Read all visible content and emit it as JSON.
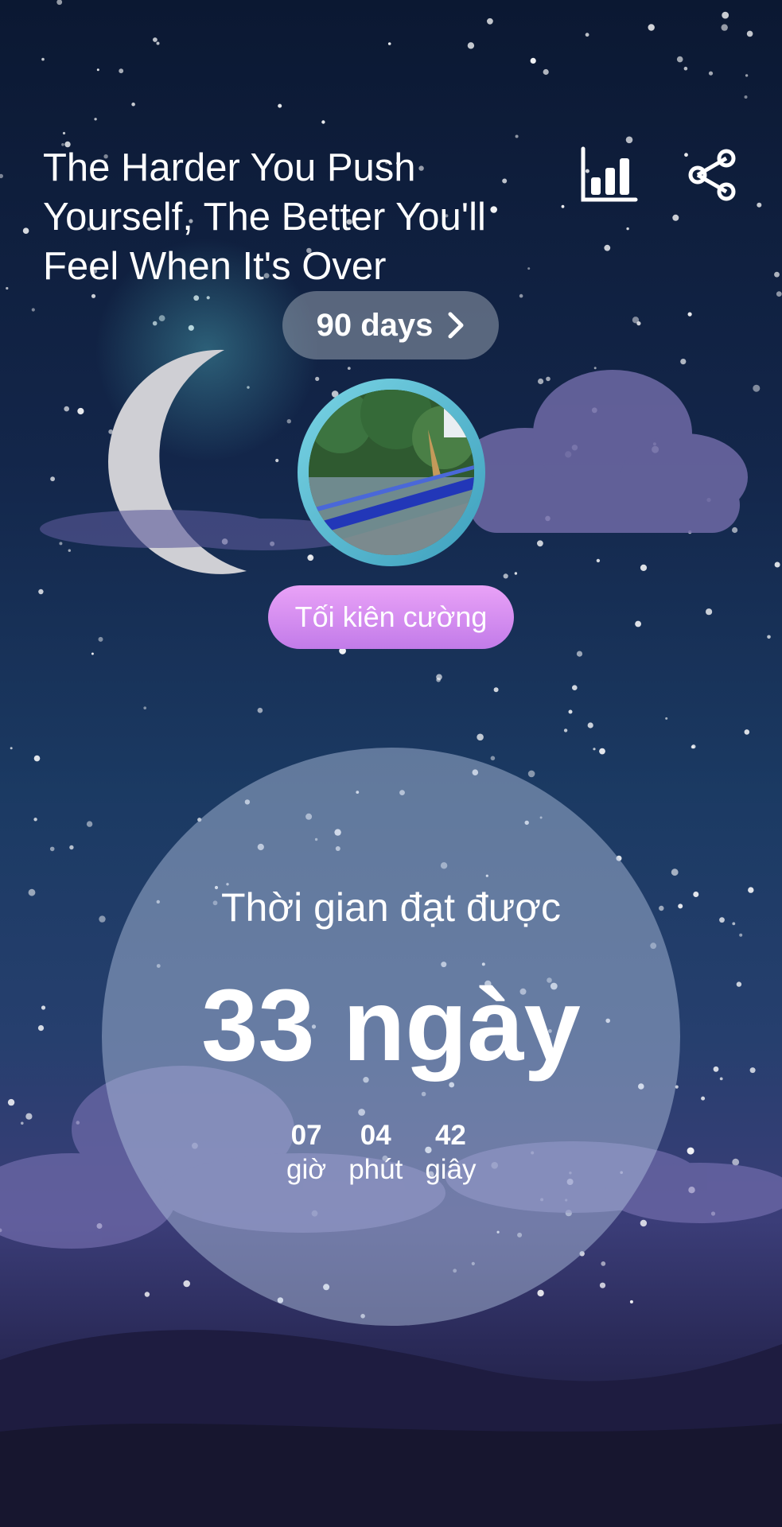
{
  "header": {
    "quote": "The Harder You Push Yourself, The Better You'll Feel When It's Over",
    "stats_icon": "bar-chart-icon",
    "share_icon": "share-icon"
  },
  "goal": {
    "label": "90 days",
    "chevron_icon": "chevron-right-icon"
  },
  "profile": {
    "name": "Tối kiên cường"
  },
  "achievement": {
    "label": "Thời gian đạt được",
    "value": "33 ngày",
    "hours": {
      "value": "07",
      "unit": "giờ"
    },
    "minutes": {
      "value": "04",
      "unit": "phút"
    },
    "seconds": {
      "value": "42",
      "unit": "giây"
    }
  },
  "colors": {
    "sky_top": "#0b1832",
    "sky_bottom": "#14132e",
    "pill_purple": "#d08ef0",
    "avatar_ring": "#5cbfd6"
  }
}
